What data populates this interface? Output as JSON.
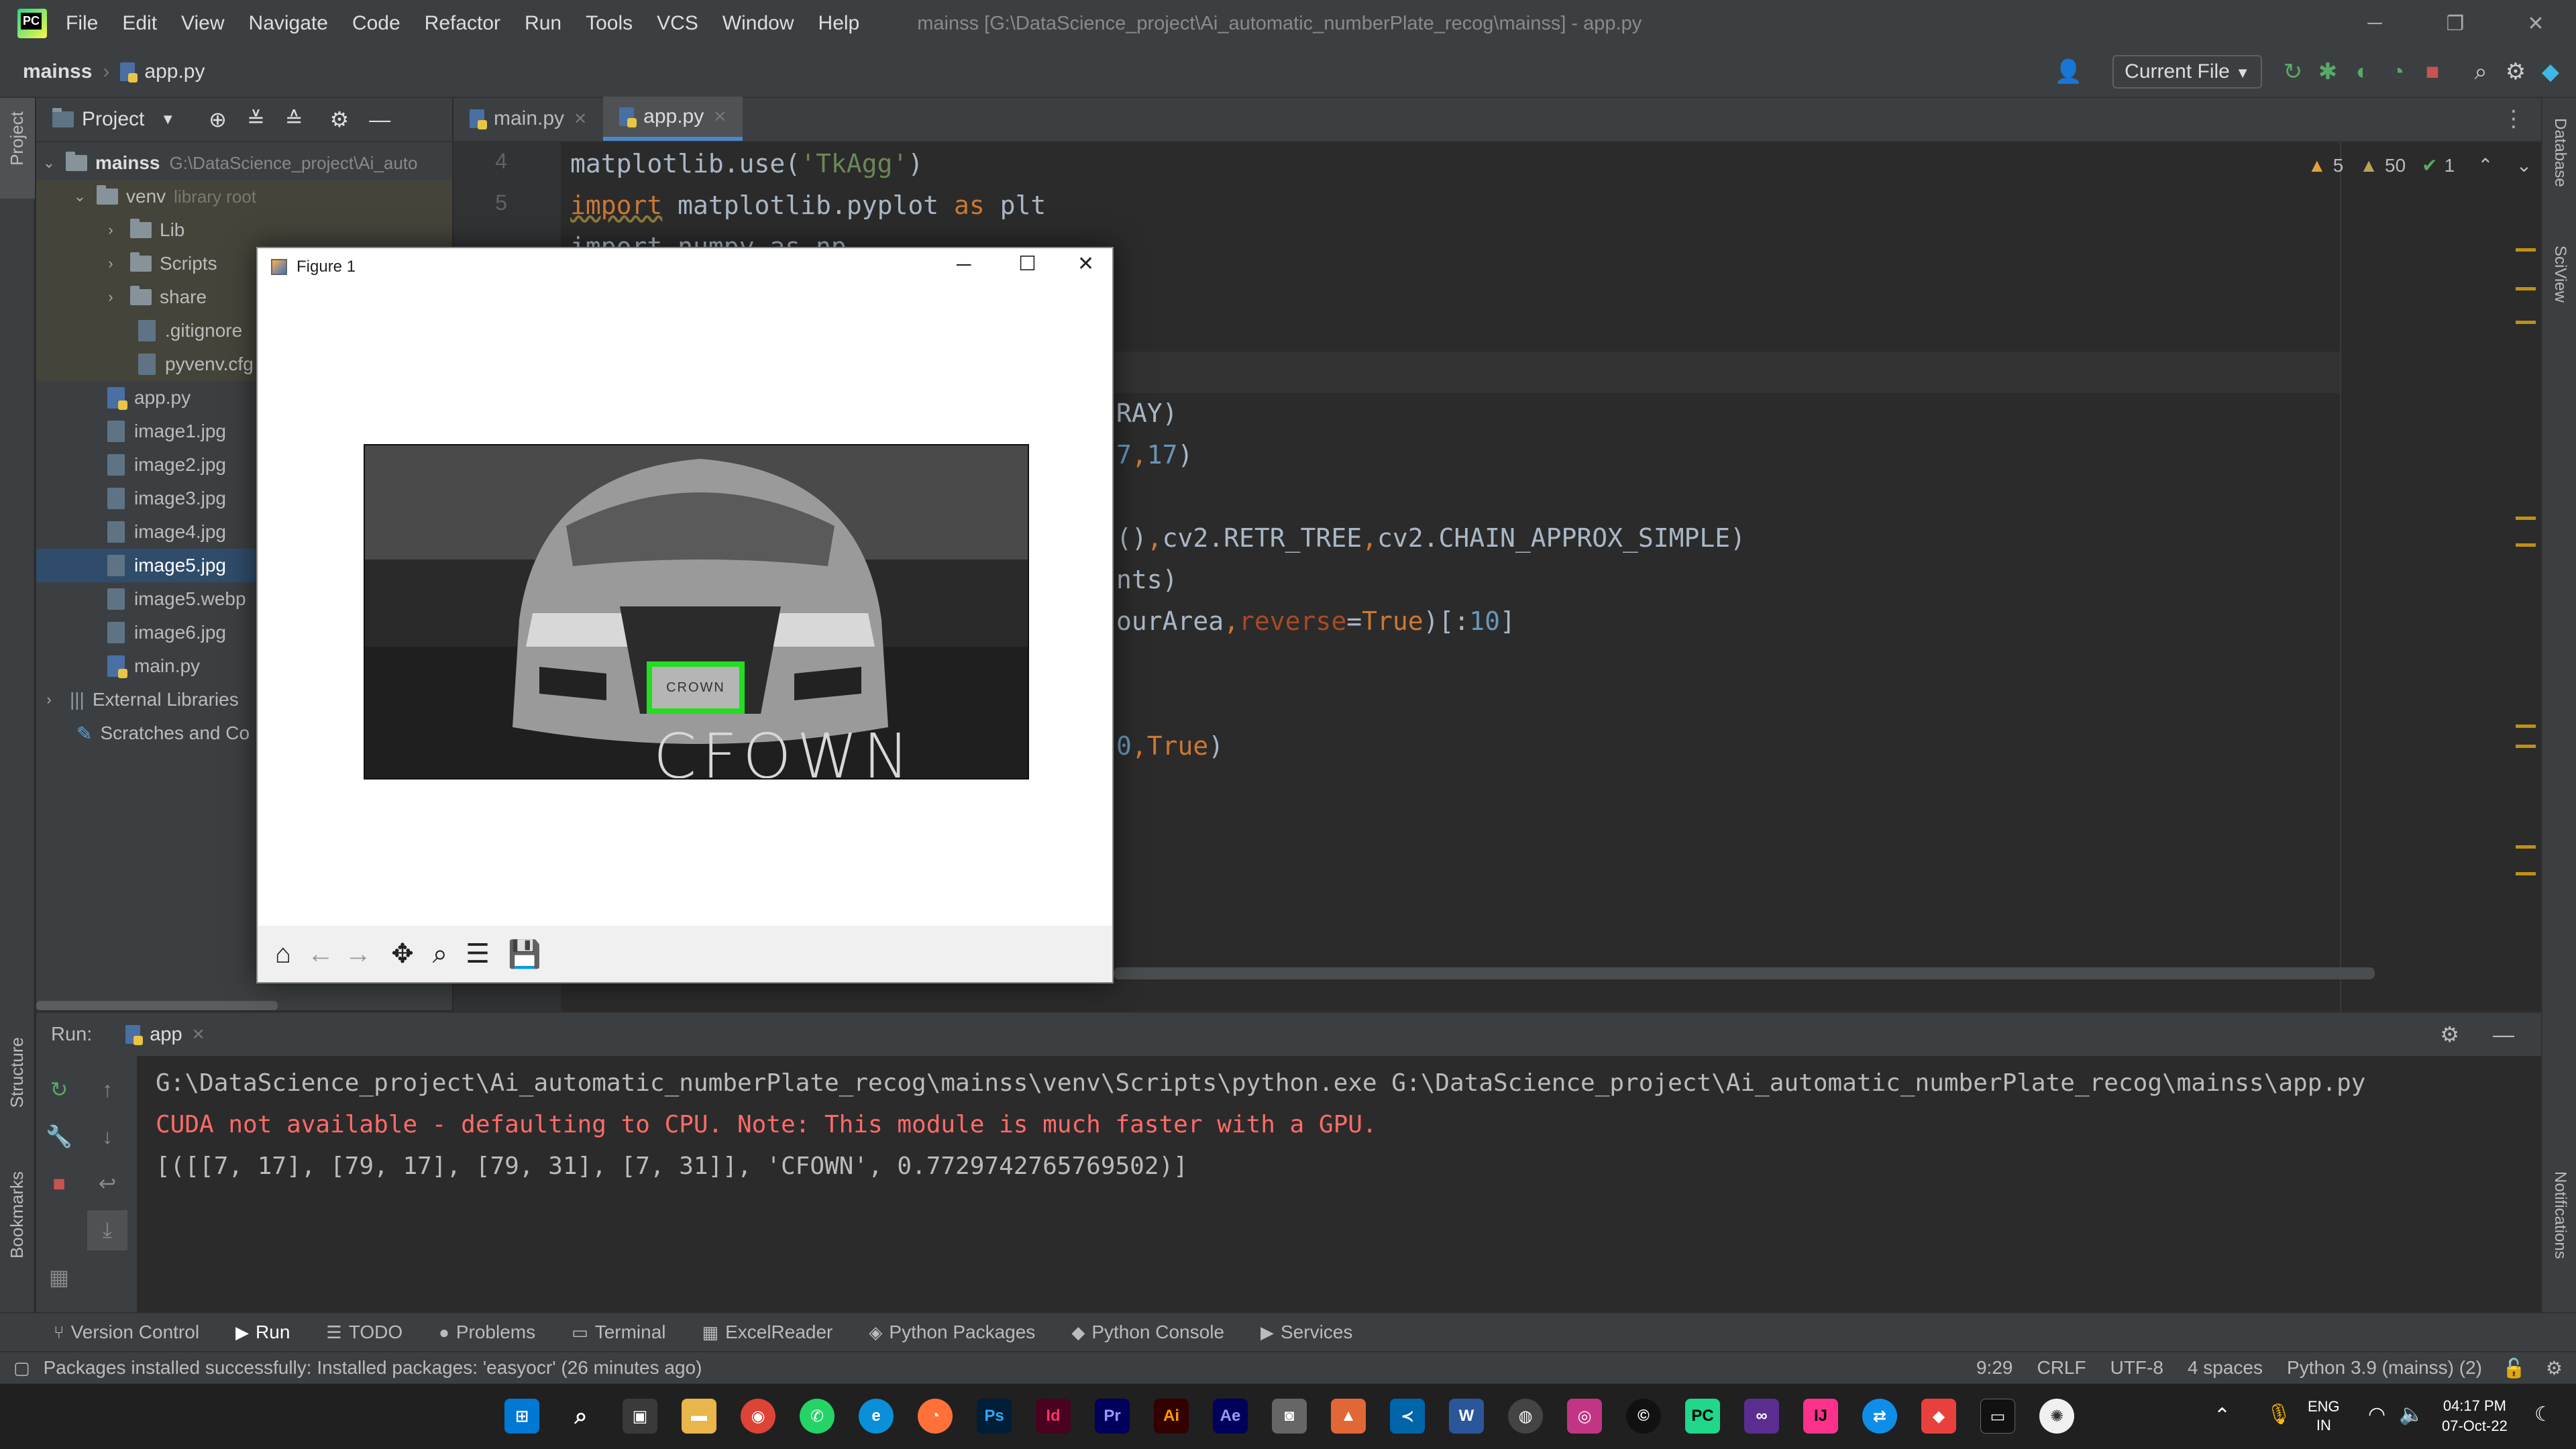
{
  "title_bar": {
    "menu": [
      "File",
      "Edit",
      "View",
      "Navigate",
      "Code",
      "Refactor",
      "Run",
      "Tools",
      "VCS",
      "Window",
      "Help"
    ],
    "window_title": "mainss [G:\\DataScience_project\\Ai_automatic_numberPlate_recog\\mainss] - app.py"
  },
  "nav": {
    "project": "mainss",
    "file": "app.py",
    "run_config": "Current File"
  },
  "left_stripe": {
    "project": "Project",
    "structure": "Structure",
    "bookmarks": "Bookmarks"
  },
  "right_stripe": {
    "database": "Database",
    "sciview": "SciView",
    "notifications": "Notifications"
  },
  "project_panel": {
    "title": "Project",
    "root": {
      "name": "mainss",
      "path": "G:\\DataScience_project\\Ai_auto"
    },
    "venv": {
      "name": "venv",
      "note": "library root"
    },
    "venv_children": [
      "Lib",
      "Scripts",
      "share"
    ],
    "venv_files": [
      ".gitignore",
      "pyvenv.cfg"
    ],
    "files": [
      "app.py",
      "image1.jpg",
      "image2.jpg",
      "image3.jpg",
      "image4.jpg",
      "image5.jpg",
      "image5.webp",
      "image6.jpg",
      "main.py"
    ],
    "selected": "image5.jpg",
    "external": "External Libraries",
    "scratches": "Scratches and Co"
  },
  "editor": {
    "tabs": [
      "main.py",
      "app.py"
    ],
    "active_tab": "app.py",
    "inspections": {
      "warn_a": "5",
      "warn_b": "50",
      "ok": "1"
    },
    "line_numbers": [
      "4",
      "5"
    ],
    "line4": {
      "a": "matplotlib.use(",
      "b": "'TkAgg'",
      "c": ")"
    },
    "line5": {
      "kw": "import",
      "rest": " matplotlib.pyplot ",
      "as": "as",
      "alias": " plt"
    },
    "line6_partial": "import numpy as np",
    "frag1": "RAY)",
    "frag2": {
      "a": "7",
      "b": ",",
      "c": "17",
      "d": ")"
    },
    "frag3": {
      "a": "()",
      "b": ",",
      "c": "cv2.RETR_TREE",
      "d": ",",
      "e": "cv2.CHAIN_APPROX_SIMPLE)"
    },
    "frag4": "nts)",
    "frag5": {
      "a": "ourArea",
      "b": ",",
      "c": "reverse",
      "d": "=",
      "e": "True",
      "f": ")[:",
      "g": "10",
      "h": "]"
    },
    "frag6": {
      "a": "0",
      "b": ",",
      "c": "True",
      "d": ")"
    }
  },
  "figure": {
    "title": "Figure 1",
    "plate_text": "CFOWN",
    "badge_text": "CROWN",
    "box_color": "#22dd22"
  },
  "run_panel": {
    "label": "Run:",
    "tab": "app",
    "line1": "G:\\DataScience_project\\Ai_automatic_numberPlate_recog\\mainss\\venv\\Scripts\\python.exe G:\\DataScience_project\\Ai_automatic_numberPlate_recog\\mainss\\app.py",
    "line2": "CUDA not available - defaulting to CPU. Note: This module is much faster with a GPU.",
    "line3": "[([[7, 17], [79, 17], [79, 31], [7, 31]], 'CFOWN', 0.7729742765769502)]"
  },
  "tool_tabs": [
    "Version Control",
    "Run",
    "TODO",
    "Problems",
    "Terminal",
    "ExcelReader",
    "Python Packages",
    "Python Console",
    "Services"
  ],
  "status": {
    "message": "Packages installed successfully: Installed packages: 'easyocr' (26 minutes ago)",
    "position": "9:29",
    "line_sep": "CRLF",
    "encoding": "UTF-8",
    "indent": "4 spaces",
    "interpreter": "Python 3.9 (mainss) (2)"
  },
  "taskbar": {
    "lang": "ENG",
    "region": "IN",
    "time": "04:17 PM",
    "date": "07-Oct-22",
    "apps": [
      "Ps",
      "Id",
      "Pr",
      "Ai",
      "Ae"
    ]
  }
}
